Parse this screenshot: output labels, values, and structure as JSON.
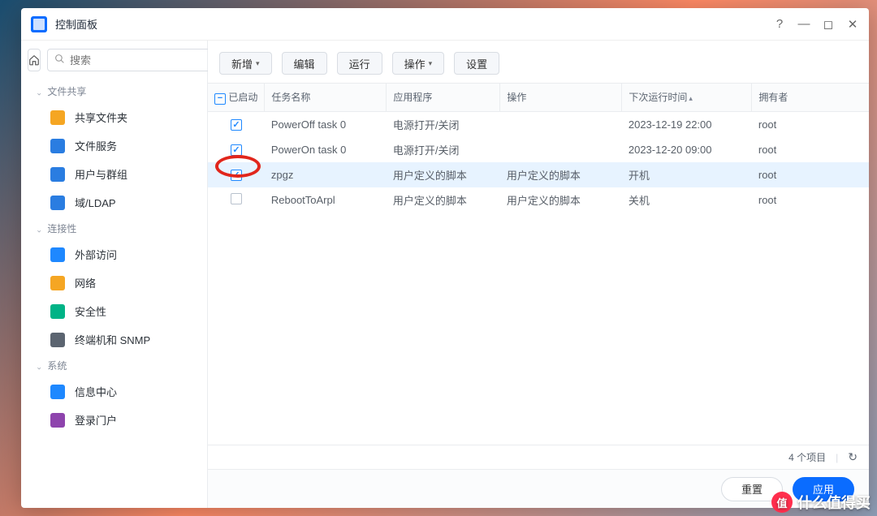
{
  "window": {
    "title": "控制面板"
  },
  "search": {
    "placeholder": "搜索"
  },
  "sidebar": {
    "groups": [
      {
        "label": "文件共享",
        "items": [
          {
            "icon": "folder-shared-icon",
            "color": "#f5a623",
            "label": "共享文件夹"
          },
          {
            "icon": "file-service-icon",
            "color": "#2a7de1",
            "label": "文件服务"
          },
          {
            "icon": "users-groups-icon",
            "color": "#2a7de1",
            "label": "用户与群组"
          },
          {
            "icon": "ldap-icon",
            "color": "#2a7de1",
            "label": "域/LDAP"
          }
        ]
      },
      {
        "label": "连接性",
        "items": [
          {
            "icon": "external-access-icon",
            "color": "#1e88ff",
            "label": "外部访问"
          },
          {
            "icon": "network-icon",
            "color": "#f5a623",
            "label": "网络"
          },
          {
            "icon": "security-shield-icon",
            "color": "#00b386",
            "label": "安全性"
          },
          {
            "icon": "terminal-snmp-icon",
            "color": "#5b6470",
            "label": "终端机和 SNMP"
          }
        ]
      },
      {
        "label": "系统",
        "items": [
          {
            "icon": "info-center-icon",
            "color": "#1e88ff",
            "label": "信息中心"
          },
          {
            "icon": "login-portal-icon",
            "color": "#8e44ad",
            "label": "登录门户"
          }
        ]
      }
    ]
  },
  "toolbar": {
    "add": "新增",
    "edit": "编辑",
    "run": "运行",
    "action": "操作",
    "settings": "设置"
  },
  "table": {
    "columns": {
      "enabled": "已启动",
      "name": "任务名称",
      "app": "应用程序",
      "op": "操作",
      "next": "下次运行时间",
      "owner": "拥有者"
    },
    "rows": [
      {
        "enabled": true,
        "name": "PowerOff task 0",
        "app": "电源打开/关闭",
        "op": "",
        "next": "2023-12-19 22:00",
        "owner": "root",
        "selected": false
      },
      {
        "enabled": true,
        "name": "PowerOn task 0",
        "app": "电源打开/关闭",
        "op": "",
        "next": "2023-12-20 09:00",
        "owner": "root",
        "selected": false
      },
      {
        "enabled": true,
        "name": "zpgz",
        "app": "用户定义的脚本",
        "op": "用户定义的脚本",
        "next": "开机",
        "owner": "root",
        "selected": true
      },
      {
        "enabled": false,
        "name": "RebootToArpl",
        "app": "用户定义的脚本",
        "op": "用户定义的脚本",
        "next": "关机",
        "owner": "root",
        "selected": false
      }
    ]
  },
  "status": {
    "count_label": "4 个项目"
  },
  "footer": {
    "reset": "重置",
    "apply": "应用"
  },
  "watermark": {
    "text": "什么值得买",
    "badge": "值"
  }
}
